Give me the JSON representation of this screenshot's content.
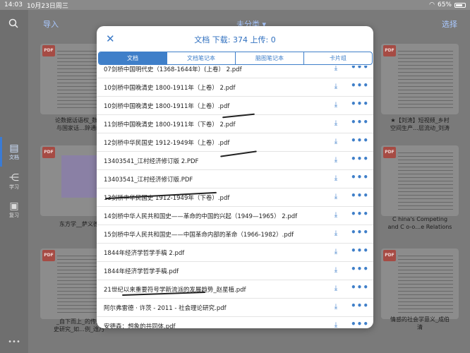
{
  "status_bar": {
    "time": "14:03",
    "date": "10月23日周三",
    "battery": "65%"
  },
  "sidebar": {
    "items": [
      {
        "label": "文档",
        "icon": "document-icon"
      },
      {
        "label": "学习",
        "icon": "share-icon"
      },
      {
        "label": "复习",
        "icon": "clipboard-icon"
      }
    ],
    "more": "•••"
  },
  "topbar": {
    "import": "导入",
    "category": "未分类 ▾",
    "select": "选择"
  },
  "background_cards": [
    {
      "title": "论数据话语权_数据\n与国家话…辞通经"
    },
    {
      "title": "★【刘涛】短视频_乡村\n空间生产…层流动_刘涛"
    },
    {
      "title": "东方学__萨义德"
    },
    {
      "title": "C hina's Competing\nand C o-o…e Relations"
    },
    {
      "title": "_自下而上_的传播\n史研究_如…例_连乃"
    },
    {
      "title": "情感的社会学意义_成伯\n清"
    }
  ],
  "modal": {
    "close": "✕",
    "title": "文档 下载: 374 上传: 0",
    "tabs": [
      "文档",
      "文档笔记本",
      "脑图笔记本",
      "卡片组"
    ],
    "files": [
      "07剑桥中国明代史（1368-1644年）(上卷） 2.pdf",
      "10剑桥中国晚清史 1800-1911年（上卷） 2.pdf",
      "10剑桥中国晚清史 1800-1911年（上卷）.pdf",
      "11剑桥中国晚清史 1800-1911年（下卷） 2.pdf",
      "12剑桥中华民国史 1912-1949年（上卷）.pdf",
      "13403541_江村经济修订版 2.PDF",
      "13403541_江村经济修订版.PDF",
      "13剑桥中华民国史 1912-1949年（下卷）.pdf",
      "14剑桥中华人民共和国史——革命的中国的兴起（1949—1965） 2.pdf",
      "15剑桥中华人民共和国史——中国革命内部的革命（1966-1982）.pdf",
      "1844年经济学哲学手稿 2.pdf",
      "1844年经济学哲学手稿.pdf",
      "21世纪以来重要符号学新流派的发展趋势_赵星植.pdf",
      "阿尔弗雷德 · 许茨 - 2011 - 社会理论研究.pdf",
      "安德森：想象的共同体.pdf"
    ]
  }
}
